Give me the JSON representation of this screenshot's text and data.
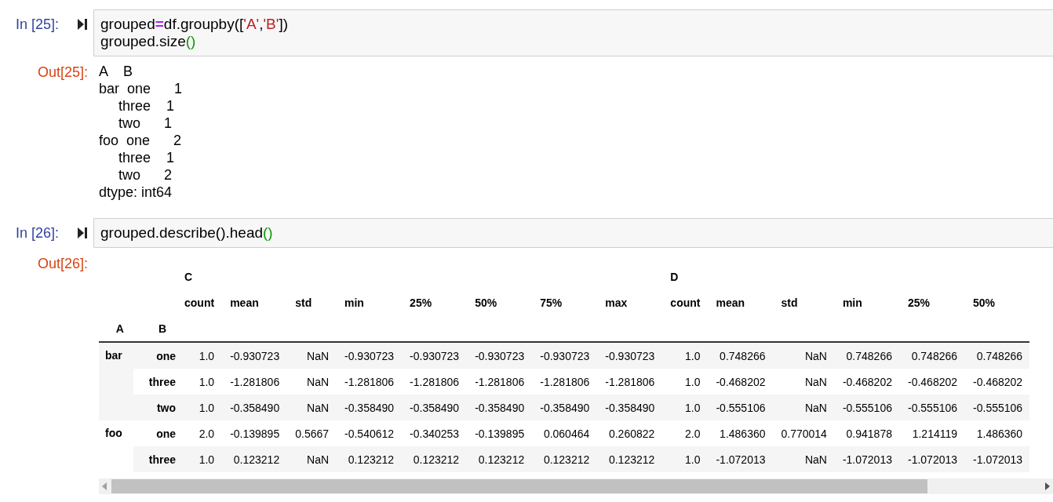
{
  "cells": [
    {
      "prompt": "In [25]:",
      "code_lines": [
        [
          {
            "kind": "plain",
            "text": "grouped"
          },
          {
            "kind": "operator",
            "text": "="
          },
          {
            "kind": "plain",
            "text": "df.groupby(["
          },
          {
            "kind": "string",
            "text": "'A'"
          },
          {
            "kind": "plain",
            "text": ","
          },
          {
            "kind": "string",
            "text": "'B'"
          },
          {
            "kind": "plain",
            "text": "])"
          }
        ],
        [
          {
            "kind": "plain",
            "text": "grouped.size"
          },
          {
            "kind": "paren",
            "text": "()"
          }
        ]
      ],
      "output": {
        "prompt": "Out[25]:",
        "kind": "text",
        "lines": [
          "A    B",
          "bar  one      1",
          "     three    1",
          "     two      1",
          "foo  one      2",
          "     three    1",
          "     two      2",
          "dtype: int64"
        ]
      }
    },
    {
      "prompt": "In [26]:",
      "code_lines": [
        [
          {
            "kind": "plain",
            "text": "grouped.describe().head"
          },
          {
            "kind": "paren",
            "text": "()"
          }
        ]
      ],
      "output": {
        "prompt": "Out[26]:",
        "kind": "table",
        "table": {
          "column_groups": [
            {
              "label": "C",
              "columns": [
                "count",
                "mean",
                "std",
                "min",
                "25%",
                "50%",
                "75%",
                "max"
              ]
            },
            {
              "label": "D",
              "columns": [
                "count",
                "mean",
                "std",
                "min",
                "25%",
                "50%"
              ]
            }
          ],
          "index_names": [
            "A",
            "B"
          ],
          "groups": [
            {
              "label": "bar",
              "rows": [
                {
                  "label": "one",
                  "values": [
                    "1.0",
                    "-0.930723",
                    "NaN",
                    "-0.930723",
                    "-0.930723",
                    "-0.930723",
                    "-0.930723",
                    "-0.930723",
                    "1.0",
                    "0.748266",
                    "NaN",
                    "0.748266",
                    "0.748266",
                    "0.748266"
                  ]
                },
                {
                  "label": "three",
                  "values": [
                    "1.0",
                    "-1.281806",
                    "NaN",
                    "-1.281806",
                    "-1.281806",
                    "-1.281806",
                    "-1.281806",
                    "-1.281806",
                    "1.0",
                    "-0.468202",
                    "NaN",
                    "-0.468202",
                    "-0.468202",
                    "-0.468202"
                  ]
                },
                {
                  "label": "two",
                  "values": [
                    "1.0",
                    "-0.358490",
                    "NaN",
                    "-0.358490",
                    "-0.358490",
                    "-0.358490",
                    "-0.358490",
                    "-0.358490",
                    "1.0",
                    "-0.555106",
                    "NaN",
                    "-0.555106",
                    "-0.555106",
                    "-0.555106"
                  ]
                }
              ]
            },
            {
              "label": "foo",
              "rows": [
                {
                  "label": "one",
                  "values": [
                    "2.0",
                    "-0.139895",
                    "0.5667",
                    "-0.540612",
                    "-0.340253",
                    "-0.139895",
                    "0.060464",
                    "0.260822",
                    "2.0",
                    "1.486360",
                    "0.770014",
                    "0.941878",
                    "1.214119",
                    "1.486360"
                  ]
                },
                {
                  "label": "three",
                  "values": [
                    "1.0",
                    "0.123212",
                    "NaN",
                    "0.123212",
                    "0.123212",
                    "0.123212",
                    "0.123212",
                    "0.123212",
                    "1.0",
                    "-1.072013",
                    "NaN",
                    "-1.072013",
                    "-1.072013",
                    "-1.072013"
                  ]
                }
              ]
            }
          ]
        }
      }
    }
  ]
}
